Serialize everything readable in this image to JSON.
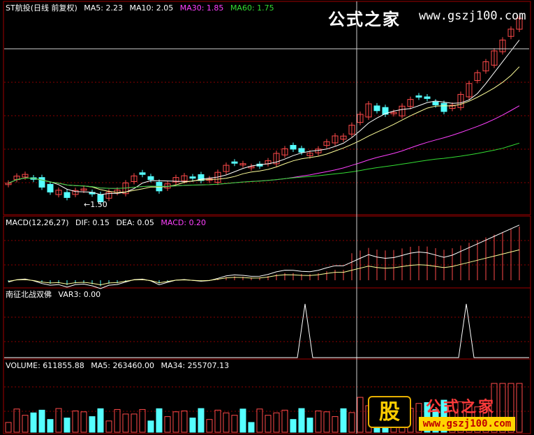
{
  "main_panel": {
    "title": "ST航投(日线 前复权)",
    "indicators": [
      {
        "label": "MA5: 2.23",
        "color": "#ffffff"
      },
      {
        "label": "MA10: 2.05",
        "color": "#ffffff"
      },
      {
        "label": "MA30: 1.85",
        "color": "#ff40ff"
      },
      {
        "label": "MA60: 1.75",
        "color": "#33dd33"
      }
    ],
    "low_marker": "←1.50"
  },
  "macd_panel": {
    "title": "MACD(12,26,27)",
    "indicators": [
      {
        "label": "DIF: 0.15",
        "color": "#ffffff"
      },
      {
        "label": "DEA: 0.05",
        "color": "#ffffff"
      },
      {
        "label": "MACD: 0.20",
        "color": "#ff40ff"
      }
    ]
  },
  "var_panel": {
    "title": "南征北战双佛",
    "indicators": [
      {
        "label": "VAR3: 0.00",
        "color": "#ffffff"
      }
    ]
  },
  "volume_panel": {
    "title": "VOLUME: 611855.88",
    "indicators": [
      {
        "label": "MA5: 263460.00",
        "color": "#ffffff"
      },
      {
        "label": "MA34: 255707.13",
        "color": "#ffffff"
      }
    ]
  },
  "watermark": {
    "title": "公式之家",
    "url": "www.gszj100.com",
    "logo_text": "股",
    "bottom_title": "公式之家",
    "bottom_url": "www.gszj100.com"
  },
  "colors": {
    "up": "#ff4a4a",
    "down": "#55ffff",
    "ma5": "#ffffff",
    "ma10": "#ffff99",
    "ma30": "#ff40ff",
    "ma60": "#33dd33",
    "grid": "#8b0000",
    "crosshair": "#d0d0d0"
  }
}
